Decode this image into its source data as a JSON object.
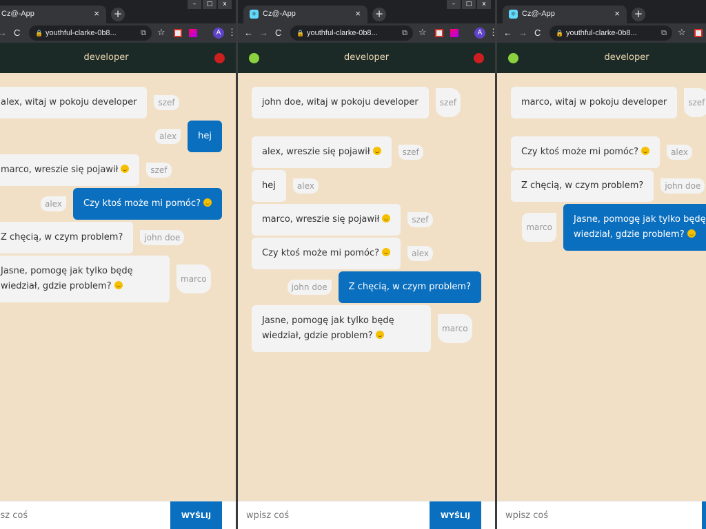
{
  "browser": {
    "tab_title": "Cz@-App",
    "url": "youthful-clarke-0b8...",
    "avatar_letter": "A"
  },
  "chat": {
    "room": "developer",
    "input_placeholder": "wpisz coś",
    "send_label": "WYŚLIJ"
  },
  "windows": [
    {
      "messages": [
        {
          "text": "alex, witaj w pokoju developer",
          "author": "szef",
          "own": false,
          "emoji": false
        },
        {
          "text": "hej",
          "author": "alex",
          "own": true,
          "emoji": false
        },
        {
          "text": "marco, wreszie się pojawił",
          "author": "szef",
          "own": false,
          "emoji": true
        },
        {
          "text": "Czy ktoś może mi pomóc?",
          "author": "alex",
          "own": true,
          "emoji": true
        },
        {
          "text": "Z chęcią, w czym problem?",
          "author": "john doe",
          "own": false,
          "emoji": false
        },
        {
          "text": "Jasne, pomogę jak tylko będę wiedział, gdzie problem?",
          "author": "marco",
          "own": false,
          "emoji": true
        }
      ]
    },
    {
      "messages": [
        {
          "text": "john doe, witaj w pokoju developer",
          "author": "szef",
          "own": false,
          "emoji": false
        },
        {
          "text": "alex, wreszie się pojawił",
          "author": "szef",
          "own": false,
          "emoji": true
        },
        {
          "text": "hej",
          "author": "alex",
          "own": false,
          "emoji": false
        },
        {
          "text": "marco, wreszie się pojawił",
          "author": "szef",
          "own": false,
          "emoji": true
        },
        {
          "text": "Czy ktoś może mi pomóc?",
          "author": "alex",
          "own": false,
          "emoji": true
        },
        {
          "text": "Z chęcią, w czym problem?",
          "author": "john doe",
          "own": true,
          "emoji": false
        },
        {
          "text": "Jasne, pomogę jak tylko będę wiedział, gdzie problem?",
          "author": "marco",
          "own": false,
          "emoji": true
        }
      ]
    },
    {
      "messages": [
        {
          "text": "marco, witaj w pokoju developer",
          "author": "szef",
          "own": false,
          "emoji": false
        },
        {
          "text": "Czy ktoś może mi pomóc?",
          "author": "alex",
          "own": false,
          "emoji": true
        },
        {
          "text": "Z chęcią, w czym problem?",
          "author": "john doe",
          "own": false,
          "emoji": false
        },
        {
          "text": "Jasne, pomogę jak tylko będę wiedział, gdzie problem?",
          "author": "marco",
          "own": true,
          "emoji": true
        }
      ]
    }
  ]
}
